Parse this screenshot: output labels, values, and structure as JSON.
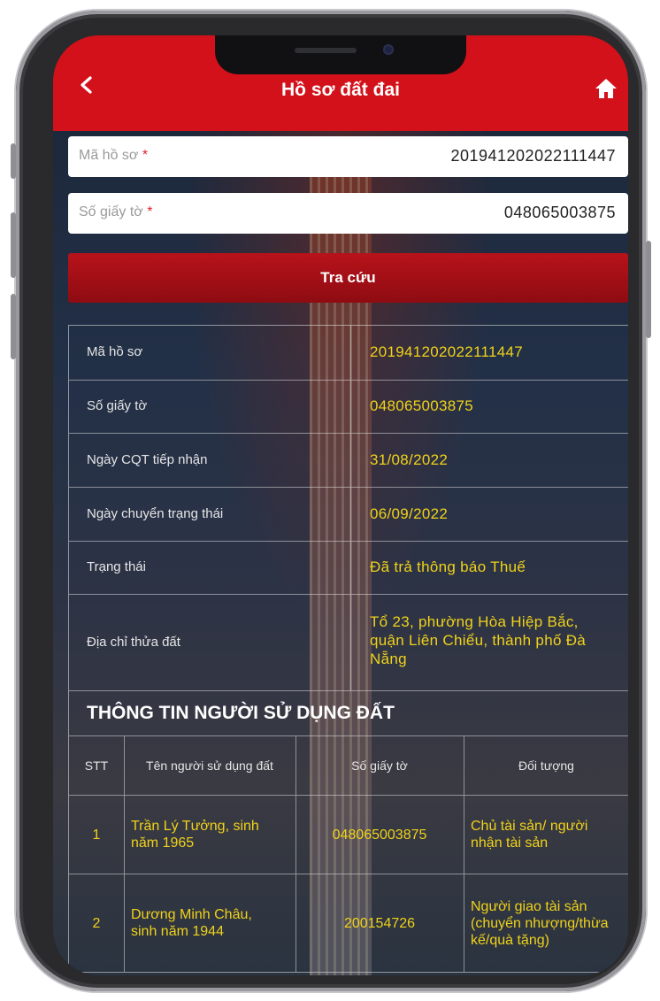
{
  "app": {
    "title": "Hồ sơ đất đai",
    "back_icon": "chevron-left-icon",
    "home_icon": "home-icon",
    "accent_color": "#d3111a",
    "value_color": "#f0d21a"
  },
  "search": {
    "ma_ho_so_placeholder": "Mã hồ sơ",
    "ma_ho_so_required": "*",
    "ma_ho_so_value": "201941202022111447",
    "so_giay_to_placeholder": "Số giấy tờ",
    "so_giay_to_required": "*",
    "so_giay_to_value": "048065003875",
    "submit_label": "Tra cứu"
  },
  "details": [
    {
      "label": "Mã hồ sơ",
      "value": "201941202022111447"
    },
    {
      "label": "Số giấy tờ",
      "value": "048065003875"
    },
    {
      "label": "Ngày CQT tiếp nhận",
      "value": "31/08/2022"
    },
    {
      "label": "Ngày chuyển trạng thái",
      "value": "06/09/2022"
    },
    {
      "label": "Trạng thái",
      "value": "Đã trả thông báo Thuế"
    },
    {
      "label": "Địa chỉ thửa đất",
      "value": "Tổ 23, phường Hòa Hiệp Bắc, quận Liên Chiểu, thành phố Đà Nẵng"
    }
  ],
  "users_section": {
    "title": "THÔNG TIN NGƯỜI SỬ DỤNG ĐẤT",
    "headers": [
      "STT",
      "Tên người sử dụng đất",
      "Số giấy tờ",
      "Đối tượng"
    ],
    "rows": [
      {
        "stt": "1",
        "name": "Trần Lý Tưởng, sinh năm 1965",
        "id": "048065003875",
        "role": "Chủ tài sản/ người nhận tài sản"
      },
      {
        "stt": "2",
        "name": "Dương Minh Châu, sinh năm 1944",
        "id": "200154726",
        "role": "Người giao tài sản (chuyển nhượng/thừa kế/quà tặng)"
      }
    ]
  }
}
